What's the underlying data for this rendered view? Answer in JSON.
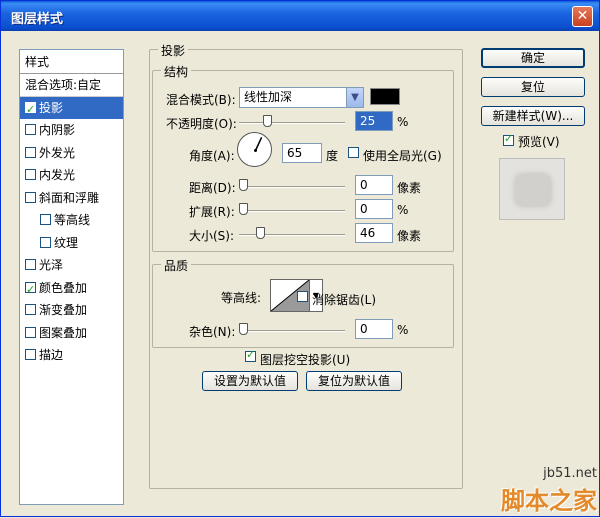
{
  "window": {
    "title": "图层样式"
  },
  "style_list": {
    "header": "样式",
    "items": [
      {
        "label": "混合选项:自定",
        "checkbox": false,
        "checked": false,
        "selected": false,
        "indent": false
      },
      {
        "label": "投影",
        "checkbox": true,
        "checked": true,
        "selected": true,
        "indent": false
      },
      {
        "label": "内阴影",
        "checkbox": true,
        "checked": false,
        "selected": false,
        "indent": false
      },
      {
        "label": "外发光",
        "checkbox": true,
        "checked": false,
        "selected": false,
        "indent": false
      },
      {
        "label": "内发光",
        "checkbox": true,
        "checked": false,
        "selected": false,
        "indent": false
      },
      {
        "label": "斜面和浮雕",
        "checkbox": true,
        "checked": false,
        "selected": false,
        "indent": false
      },
      {
        "label": "等高线",
        "checkbox": true,
        "checked": false,
        "selected": false,
        "indent": true
      },
      {
        "label": "纹理",
        "checkbox": true,
        "checked": false,
        "selected": false,
        "indent": true
      },
      {
        "label": "光泽",
        "checkbox": true,
        "checked": false,
        "selected": false,
        "indent": false
      },
      {
        "label": "颜色叠加",
        "checkbox": true,
        "checked": true,
        "selected": false,
        "indent": false
      },
      {
        "label": "渐变叠加",
        "checkbox": true,
        "checked": false,
        "selected": false,
        "indent": false
      },
      {
        "label": "图案叠加",
        "checkbox": true,
        "checked": false,
        "selected": false,
        "indent": false
      },
      {
        "label": "描边",
        "checkbox": true,
        "checked": false,
        "selected": false,
        "indent": false
      }
    ]
  },
  "panel": {
    "title": "投影",
    "structure": {
      "title": "结构",
      "blend_mode_label": "混合模式(B):",
      "blend_mode_value": "线性加深",
      "blend_color": "#000000",
      "opacity_label": "不透明度(O):",
      "opacity_value": "25",
      "opacity_unit": "%",
      "opacity_fraction": 0.25,
      "angle_label": "角度(A):",
      "angle_value": "65",
      "angle_unit": "度",
      "global_light_label": "使用全局光(G)",
      "global_light_checked": false,
      "distance_label": "距离(D):",
      "distance_value": "0",
      "distance_unit": "像素",
      "distance_fraction": 0,
      "spread_label": "扩展(R):",
      "spread_value": "0",
      "spread_unit": "%",
      "spread_fraction": 0,
      "size_label": "大小(S):",
      "size_value": "46",
      "size_unit": "像素",
      "size_fraction": 0.18
    },
    "quality": {
      "title": "品质",
      "contour_label": "等高线:",
      "anti_alias_label": "消除锯齿(L)",
      "anti_alias_checked": false,
      "noise_label": "杂色(N):",
      "noise_value": "0",
      "noise_unit": "%",
      "noise_fraction": 0
    },
    "knockout_label": "图层挖空投影(U)",
    "knockout_checked": true,
    "make_default_label": "设置为默认值",
    "reset_default_label": "复位为默认值"
  },
  "buttons": {
    "ok": "确定",
    "reset": "复位",
    "new_style": "新建样式(W)...",
    "preview_label": "预览(V)",
    "preview_checked": true
  },
  "watermark": {
    "site": "jb51.net",
    "brand": "脚本之家"
  }
}
